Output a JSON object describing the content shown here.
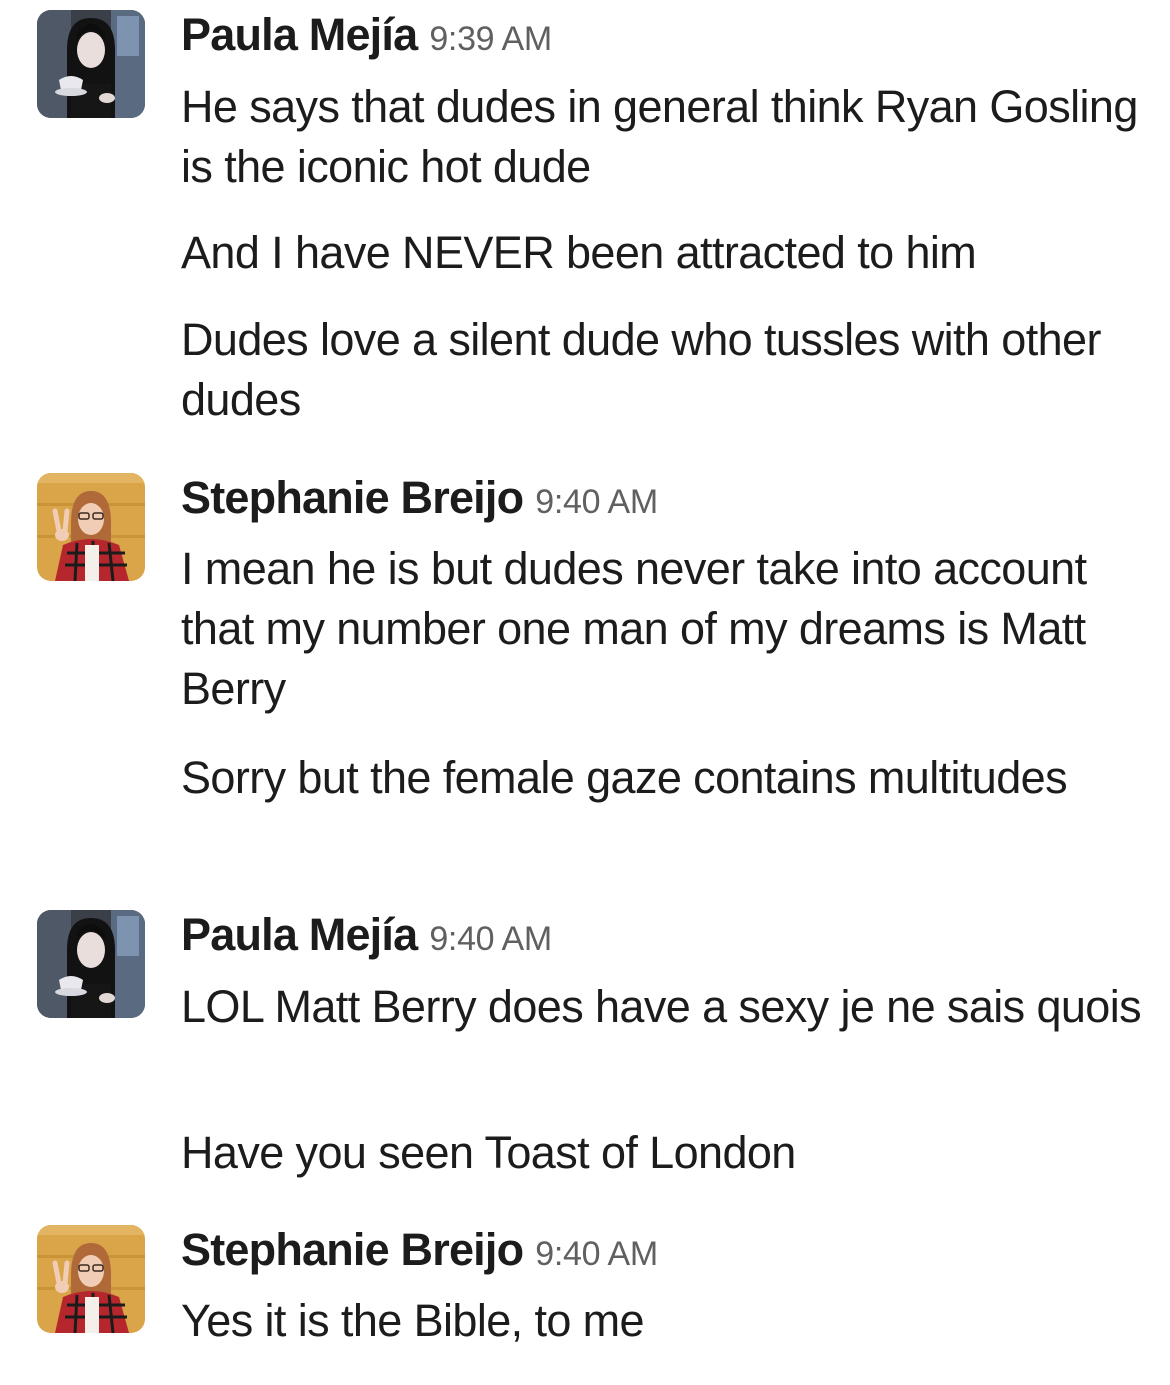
{
  "messages": [
    {
      "author": "Paula Mejía",
      "time": "9:39 AM",
      "avatar_icon": "woman-with-teacup-avatar",
      "lines": [
        "He says that dudes in general think Ryan Gosling is the iconic hot dude",
        "And I have NEVER been attracted to him",
        "Dudes love a silent dude who tussles with other dudes"
      ]
    },
    {
      "author": "Stephanie Breijo",
      "time": "9:40 AM",
      "avatar_icon": "woman-peace-sign-avatar",
      "lines": [
        "I mean he is but dudes never take into account that my number one man of my dreams is Matt Berry",
        "Sorry but the female gaze contains multitudes"
      ]
    },
    {
      "author": "Paula Mejía",
      "time": "9:40 AM",
      "avatar_icon": "woman-with-teacup-avatar",
      "lines": [
        "LOL Matt Berry does have a sexy je ne sais quois",
        "Have you seen Toast of London"
      ]
    },
    {
      "author": "Stephanie Breijo",
      "time": "9:40 AM",
      "avatar_icon": "woman-peace-sign-avatar",
      "lines": [
        "Yes it is the Bible, to me"
      ]
    }
  ]
}
